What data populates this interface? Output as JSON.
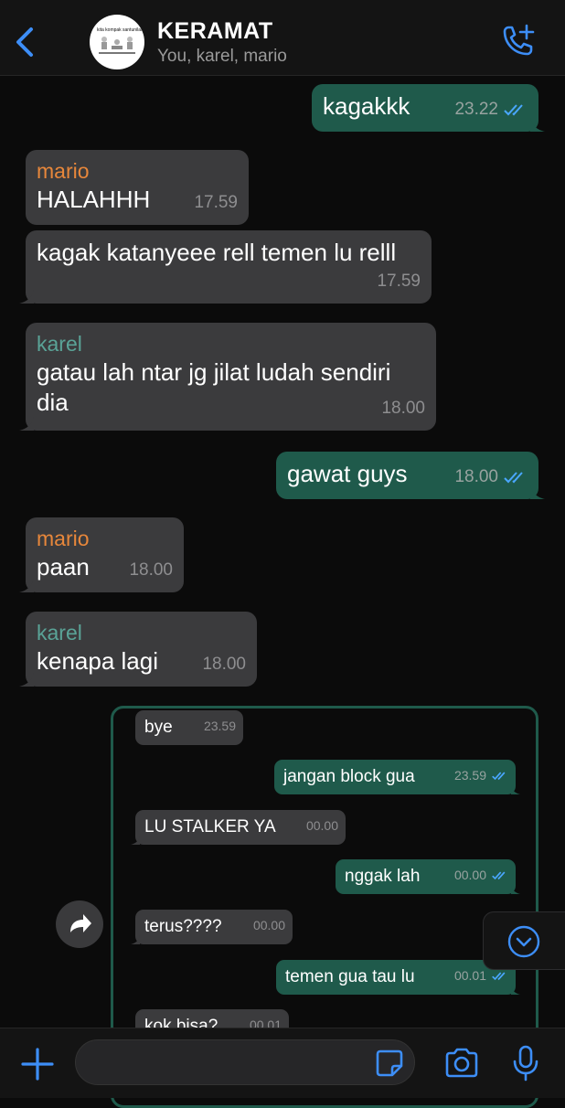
{
  "header": {
    "title": "KERAMAT",
    "subtitle": "You, karel, mario",
    "avatar_text_left": "kita kompak",
    "avatar_text_right": "santunilah"
  },
  "messages": [
    {
      "dir": "out",
      "text": "kagakkk",
      "time": "23.22",
      "read": true
    },
    {
      "dir": "in",
      "sender": "mario",
      "text": "HALAHHH",
      "time": "17.59"
    },
    {
      "dir": "in",
      "text": "kagak katanyeee rell temen lu relll",
      "time": "17.59"
    },
    {
      "dir": "in",
      "sender": "karel",
      "text": "gatau lah ntar jg jilat ludah sendiri dia",
      "time": "18.00"
    },
    {
      "dir": "out",
      "text": "gawat guys",
      "time": "18.00",
      "read": true
    },
    {
      "dir": "in",
      "sender": "mario",
      "text": "paan",
      "time": "18.00"
    },
    {
      "dir": "in",
      "sender": "karel",
      "text": "kenapa lagi",
      "time": "18.00"
    }
  ],
  "forwarded": [
    {
      "dir": "in",
      "text": "bye",
      "time": "23.59"
    },
    {
      "dir": "out",
      "text": "jangan block gua",
      "time": "23.59"
    },
    {
      "dir": "in",
      "text": "LU STALKER YA",
      "time": "00.00"
    },
    {
      "dir": "out",
      "text": "nggak lah",
      "time": "00.00"
    },
    {
      "dir": "in",
      "text": "terus????",
      "time": "00.00"
    },
    {
      "dir": "out",
      "text": "temen gua tau lu",
      "time": "00.01"
    },
    {
      "dir": "in",
      "text": "kok bisa?",
      "time": "00.01"
    }
  ],
  "input": {
    "placeholder": ""
  },
  "colors": {
    "incoming": "#3b3b3d",
    "outgoing": "#1f5a4b",
    "accent": "#3d8ef7",
    "mario": "#e7873b",
    "karel": "#5aa397"
  },
  "icons": [
    "back-chevron-icon",
    "add-call-icon",
    "forward-icon",
    "scroll-down-icon",
    "plus-icon",
    "sticker-icon",
    "camera-icon",
    "microphone-icon",
    "double-check-icon"
  ]
}
